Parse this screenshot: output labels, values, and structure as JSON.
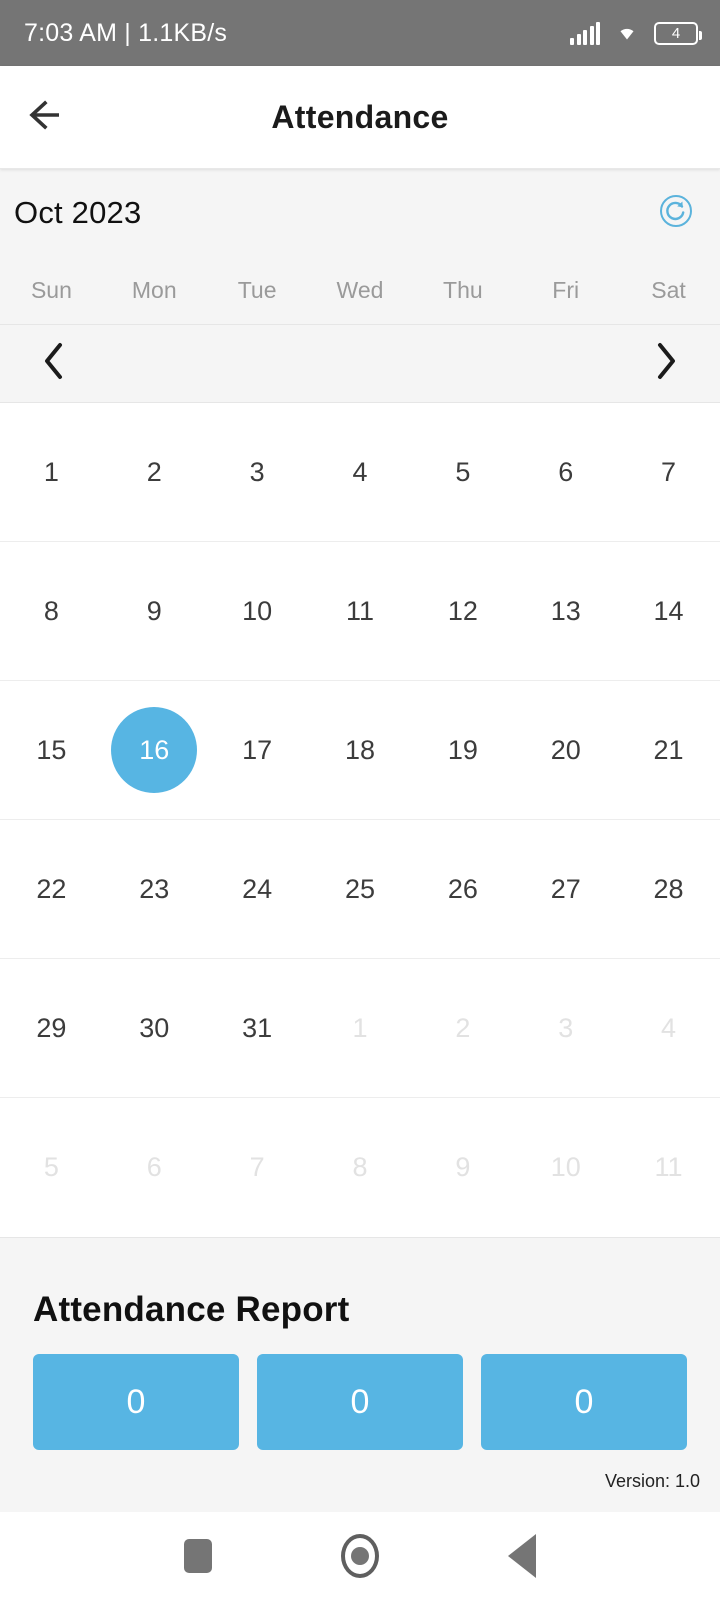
{
  "statusbar": {
    "time_and_speed": "7:03 AM | 1.1KB/s",
    "battery_level": "4",
    "icons": [
      "signal-icon",
      "wifi-icon",
      "battery-icon"
    ]
  },
  "appbar": {
    "title": "Attendance",
    "back_icon": "arrow-left-icon"
  },
  "calendar": {
    "month_label": "Oct 2023",
    "refresh_icon": "refresh-icon",
    "prev_icon": "chevron-left-icon",
    "next_icon": "chevron-right-icon",
    "weekdays": [
      "Sun",
      "Mon",
      "Tue",
      "Wed",
      "Thu",
      "Fri",
      "Sat"
    ],
    "selected_day": "16",
    "accent_color": "#57b5e3",
    "weeks": [
      [
        {
          "label": "1",
          "out": false
        },
        {
          "label": "2",
          "out": false
        },
        {
          "label": "3",
          "out": false
        },
        {
          "label": "4",
          "out": false
        },
        {
          "label": "5",
          "out": false
        },
        {
          "label": "6",
          "out": false
        },
        {
          "label": "7",
          "out": false
        }
      ],
      [
        {
          "label": "8",
          "out": false
        },
        {
          "label": "9",
          "out": false
        },
        {
          "label": "10",
          "out": false
        },
        {
          "label": "11",
          "out": false
        },
        {
          "label": "12",
          "out": false
        },
        {
          "label": "13",
          "out": false
        },
        {
          "label": "14",
          "out": false
        }
      ],
      [
        {
          "label": "15",
          "out": false
        },
        {
          "label": "16",
          "out": false,
          "selected": true
        },
        {
          "label": "17",
          "out": false
        },
        {
          "label": "18",
          "out": false
        },
        {
          "label": "19",
          "out": false
        },
        {
          "label": "20",
          "out": false
        },
        {
          "label": "21",
          "out": false
        }
      ],
      [
        {
          "label": "22",
          "out": false
        },
        {
          "label": "23",
          "out": false
        },
        {
          "label": "24",
          "out": false
        },
        {
          "label": "25",
          "out": false
        },
        {
          "label": "26",
          "out": false
        },
        {
          "label": "27",
          "out": false
        },
        {
          "label": "28",
          "out": false
        }
      ],
      [
        {
          "label": "29",
          "out": false
        },
        {
          "label": "30",
          "out": false
        },
        {
          "label": "31",
          "out": false
        },
        {
          "label": "1",
          "out": true
        },
        {
          "label": "2",
          "out": true
        },
        {
          "label": "3",
          "out": true
        },
        {
          "label": "4",
          "out": true
        }
      ],
      [
        {
          "label": "5",
          "out": true
        },
        {
          "label": "6",
          "out": true
        },
        {
          "label": "7",
          "out": true
        },
        {
          "label": "8",
          "out": true
        },
        {
          "label": "9",
          "out": true
        },
        {
          "label": "10",
          "out": true
        },
        {
          "label": "11",
          "out": true
        }
      ]
    ]
  },
  "report": {
    "title": "Attendance Report",
    "cards": [
      "0",
      "0",
      "0"
    ],
    "version": "Version: 1.0"
  },
  "navbar": {
    "recents_icon": "square-recents-icon",
    "home_icon": "circle-home-icon",
    "back_icon": "triangle-back-icon"
  }
}
